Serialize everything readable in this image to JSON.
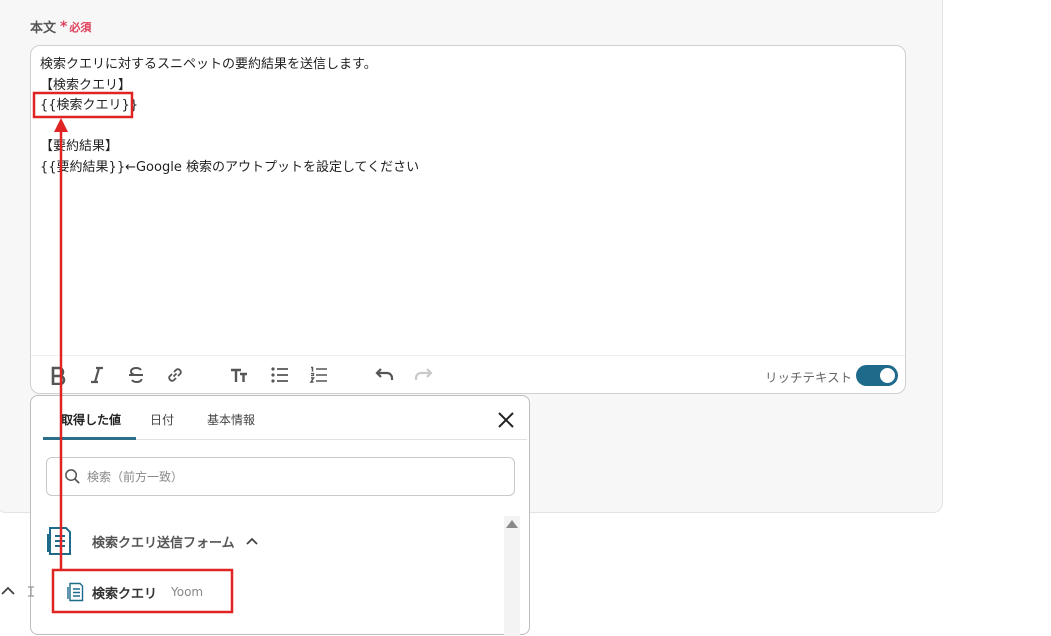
{
  "field": {
    "label": "本文",
    "asterisk": "*",
    "required": "必須"
  },
  "editor": {
    "lines": [
      "検索クエリに対するスニペットの要約結果を送信します。",
      "【検索クエリ】",
      "{{検索クエリ}}",
      "",
      "【要約結果】",
      "{{要約結果}}←Google 検索のアウトプットを設定してください"
    ],
    "rich_text_label": "リッチテキスト",
    "rich_text_on": true
  },
  "toolbar_icons": [
    "bold-icon",
    "italic-icon",
    "strikethrough-icon",
    "link-icon",
    "text-size-icon",
    "bullet-list-icon",
    "numbered-list-icon",
    "undo-icon",
    "redo-icon"
  ],
  "popup": {
    "tabs": [
      "取得した値",
      "日付",
      "基本情報"
    ],
    "active_tab": 0,
    "search_placeholder": "検索（前方一致）",
    "group_label": "検索クエリ送信フォーム",
    "item_label": "検索クエリ",
    "item_source": "Yoom"
  },
  "colors": {
    "accent": "#1d6a8a",
    "required": "#e0405a",
    "annotation": "#e02424"
  }
}
